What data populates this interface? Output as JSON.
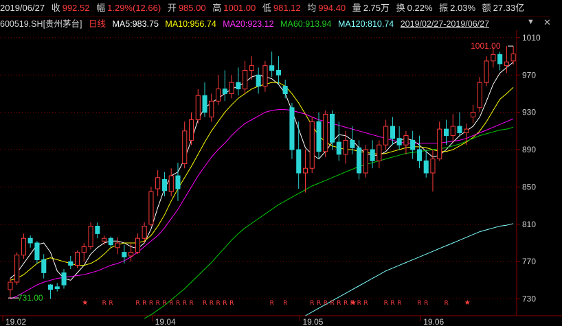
{
  "quote": {
    "date": "2019/06/27",
    "close_label": "收",
    "close": "992.52",
    "change_label": "幅",
    "change": "1.29%(12.66)",
    "open_label": "开",
    "open": "985.00",
    "high_label": "高",
    "high": "1001.00",
    "low_label": "低",
    "low": "981.12",
    "avg_label": "均",
    "avg": "994.40",
    "volume_label": "量",
    "volume": "2.75万",
    "turnover_label": "换",
    "turnover": "0.22%",
    "amplitude_label": "振",
    "amplitude": "2.03%",
    "amount_label": "额",
    "amount": "27.33亿"
  },
  "header": {
    "code": "600519.SH",
    "name": "[贵州茅台]",
    "kline_type": "日线",
    "ma5": "MA5:983.75",
    "ma10": "MA10:956.74",
    "ma20": "MA20:923.12",
    "ma60": "MA60:913.94",
    "ma120": "MA120:810.74",
    "date_range": "2019/02/27-2019/06/27"
  },
  "colors": {
    "background": "#000000",
    "up": "#ff3b3b",
    "down": "#2bd5d5",
    "ma5": "#ffffff",
    "ma10": "#ffff00",
    "ma20": "#ff00ff",
    "ma60": "#00cc00",
    "ma120": "#7fffff",
    "grid": "#8b0000",
    "axis_text": "#d0d0d0"
  },
  "icons": {
    "dropdown": "chevron-down-icon",
    "close": "close-icon",
    "star": "star-marker-icon"
  },
  "chart_data": {
    "type": "candlestick",
    "y_ticks": [
      730,
      770,
      810,
      850,
      890,
      930,
      970,
      1010
    ],
    "x_ticks": [
      "19.02",
      "19.04",
      "19.05",
      "19.06"
    ],
    "ylim": [
      712,
      1018
    ],
    "grid": true,
    "annotations": {
      "high_label": "1001.00",
      "low_label": "731.00"
    },
    "markers": [
      {
        "text": "★",
        "type": "star",
        "positions": [
          11,
          51,
          97
        ]
      },
      {
        "text": "R",
        "type": "r",
        "positions": [
          14,
          15,
          19,
          20,
          21,
          22,
          23,
          24,
          25,
          26,
          27,
          29,
          30,
          31,
          32,
          33,
          39,
          41,
          45,
          46,
          47,
          48,
          49,
          50,
          51,
          52,
          53,
          56,
          57,
          58,
          61,
          62,
          65
        ]
      },
      {
        "text": "★",
        "type": "star-red",
        "positions": [
          68
        ]
      }
    ],
    "candles": [
      [
        740,
        752,
        731,
        748
      ],
      [
        748,
        780,
        745,
        777
      ],
      [
        777,
        800,
        773,
        795
      ],
      [
        795,
        798,
        785,
        790
      ],
      [
        790,
        792,
        768,
        772
      ],
      [
        772,
        778,
        752,
        758
      ],
      [
        745,
        746,
        730,
        740
      ],
      [
        743,
        747,
        738,
        741
      ],
      [
        758,
        762,
        741,
        745
      ],
      [
        770,
        776,
        762,
        766
      ],
      [
        766,
        782,
        763,
        780
      ],
      [
        780,
        790,
        770,
        786
      ],
      [
        786,
        812,
        783,
        808
      ],
      [
        808,
        812,
        795,
        800
      ],
      [
        792,
        798,
        788,
        795
      ],
      [
        795,
        797,
        785,
        788
      ],
      [
        785,
        796,
        778,
        790
      ],
      [
        780,
        788,
        768,
        775
      ],
      [
        776,
        790,
        770,
        780
      ],
      [
        780,
        800,
        778,
        795
      ],
      [
        795,
        812,
        790,
        808
      ],
      [
        810,
        850,
        808,
        845
      ],
      [
        848,
        868,
        840,
        860
      ],
      [
        858,
        866,
        840,
        846
      ],
      [
        845,
        870,
        840,
        862
      ],
      [
        862,
        876,
        835,
        848
      ],
      [
        875,
        920,
        870,
        910
      ],
      [
        900,
        930,
        895,
        922
      ],
      [
        922,
        955,
        918,
        948
      ],
      [
        948,
        962,
        925,
        930
      ],
      [
        925,
        950,
        920,
        942
      ],
      [
        942,
        970,
        938,
        955
      ],
      [
        955,
        975,
        942,
        950
      ],
      [
        950,
        970,
        945,
        962
      ],
      [
        962,
        978,
        948,
        955
      ],
      [
        955,
        985,
        950,
        975
      ],
      [
        975,
        990,
        965,
        980
      ],
      [
        970,
        978,
        950,
        958
      ],
      [
        958,
        985,
        952,
        980
      ],
      [
        980,
        995,
        968,
        975
      ],
      [
        975,
        990,
        960,
        970
      ],
      [
        958,
        965,
        945,
        950
      ],
      [
        935,
        940,
        880,
        890
      ],
      [
        890,
        920,
        848,
        865
      ],
      [
        865,
        890,
        844,
        870
      ],
      [
        870,
        925,
        865,
        920
      ],
      [
        920,
        930,
        880,
        888
      ],
      [
        888,
        932,
        882,
        928
      ],
      [
        928,
        932,
        890,
        898
      ],
      [
        898,
        920,
        878,
        885
      ],
      [
        885,
        910,
        875,
        900
      ],
      [
        900,
        915,
        885,
        892
      ],
      [
        892,
        900,
        858,
        865
      ],
      [
        865,
        895,
        860,
        890
      ],
      [
        890,
        900,
        870,
        878
      ],
      [
        878,
        900,
        870,
        895
      ],
      [
        895,
        922,
        890,
        915
      ],
      [
        915,
        925,
        895,
        902
      ],
      [
        902,
        915,
        890,
        895
      ],
      [
        895,
        910,
        885,
        905
      ],
      [
        900,
        910,
        880,
        890
      ],
      [
        890,
        905,
        870,
        878
      ],
      [
        878,
        890,
        860,
        865
      ],
      [
        865,
        890,
        845,
        880
      ],
      [
        880,
        920,
        878,
        912
      ],
      [
        912,
        922,
        895,
        905
      ],
      [
        905,
        928,
        898,
        915
      ],
      [
        915,
        930,
        905,
        908
      ],
      [
        908,
        918,
        895,
        912
      ],
      [
        925,
        938,
        918,
        930
      ],
      [
        935,
        968,
        930,
        962
      ],
      [
        962,
        990,
        958,
        985
      ],
      [
        985,
        1000,
        978,
        992
      ],
      [
        992,
        995,
        975,
        982
      ],
      [
        980,
        1001,
        972,
        984
      ],
      [
        985,
        1001,
        981.12,
        992.52
      ]
    ],
    "series": [
      {
        "name": "MA5",
        "values": [
          752,
          758,
          768,
          778,
          788,
          790,
          780,
          760,
          752,
          750,
          758,
          766,
          778,
          785,
          790,
          792,
          792,
          790,
          786,
          784,
          790,
          805,
          828,
          848,
          862,
          866,
          880,
          900,
          922,
          935,
          940,
          945,
          950,
          955,
          958,
          962,
          968,
          970,
          968,
          966,
          960,
          950,
          932,
          912,
          892,
          885,
          880,
          888,
          898,
          906,
          905,
          900,
          892,
          886,
          884,
          884,
          888,
          896,
          900,
          902,
          900,
          895,
          888,
          882,
          884,
          890,
          898,
          905,
          910,
          915,
          925,
          942,
          960,
          972,
          978,
          983.75
        ]
      },
      {
        "name": "MA10",
        "values": [
          750,
          752,
          756,
          762,
          768,
          772,
          774,
          772,
          770,
          768,
          766,
          766,
          768,
          772,
          778,
          785,
          788,
          790,
          790,
          790,
          792,
          798,
          808,
          820,
          835,
          848,
          860,
          872,
          885,
          898,
          910,
          920,
          930,
          938,
          945,
          950,
          955,
          958,
          960,
          962,
          962,
          958,
          950,
          940,
          928,
          916,
          905,
          898,
          894,
          892,
          890,
          890,
          888,
          887,
          886,
          885,
          886,
          888,
          890,
          892,
          893,
          893,
          892,
          890,
          888,
          888,
          890,
          894,
          898,
          903,
          910,
          920,
          932,
          944,
          950,
          956.74
        ]
      },
      {
        "name": "MA20",
        "values": [
          730,
          733,
          737,
          741,
          745,
          748,
          750,
          752,
          753,
          754,
          755,
          756,
          758,
          760,
          763,
          766,
          768,
          771,
          775,
          780,
          786,
          792,
          798,
          806,
          816,
          826,
          838,
          850,
          862,
          872,
          882,
          890,
          897,
          905,
          912,
          918,
          922,
          926,
          930,
          932,
          933,
          933,
          932,
          930,
          928,
          925,
          922,
          920,
          918,
          916,
          914,
          912,
          910,
          908,
          906,
          904,
          902,
          900,
          898,
          897,
          897,
          897,
          897,
          897,
          897,
          898,
          899,
          900,
          902,
          905,
          908,
          911,
          914,
          917,
          920,
          923.12
        ]
      },
      {
        "name": "MA60",
        "values": [
          null,
          null,
          null,
          null,
          null,
          null,
          null,
          null,
          null,
          null,
          null,
          null,
          null,
          null,
          null,
          null,
          null,
          null,
          null,
          null,
          709,
          713,
          718,
          723,
          729,
          735,
          741,
          748,
          755,
          762,
          769,
          777,
          785,
          793,
          800,
          806,
          811,
          816,
          821,
          826,
          831,
          835,
          839,
          843,
          847,
          851,
          854,
          857,
          860,
          863,
          866,
          869,
          872,
          874,
          876,
          878,
          880,
          882,
          884,
          886,
          887,
          888,
          889,
          890,
          891,
          892,
          894,
          896,
          899,
          902,
          905,
          907,
          909,
          911,
          912,
          913.94
        ]
      },
      {
        "name": "MA120",
        "values": [
          null,
          null,
          null,
          null,
          null,
          null,
          null,
          null,
          null,
          null,
          null,
          null,
          null,
          null,
          null,
          null,
          null,
          null,
          null,
          null,
          null,
          null,
          null,
          null,
          null,
          null,
          null,
          null,
          null,
          null,
          null,
          null,
          null,
          null,
          null,
          null,
          null,
          null,
          null,
          null,
          null,
          null,
          null,
          null,
          712,
          716,
          720,
          724,
          728,
          732,
          736,
          740,
          744,
          748,
          752,
          756,
          760,
          763,
          766,
          769,
          772,
          775,
          778,
          781,
          784,
          787,
          790,
          793,
          796,
          799,
          802,
          804,
          806,
          808,
          809,
          810.74
        ]
      }
    ]
  }
}
